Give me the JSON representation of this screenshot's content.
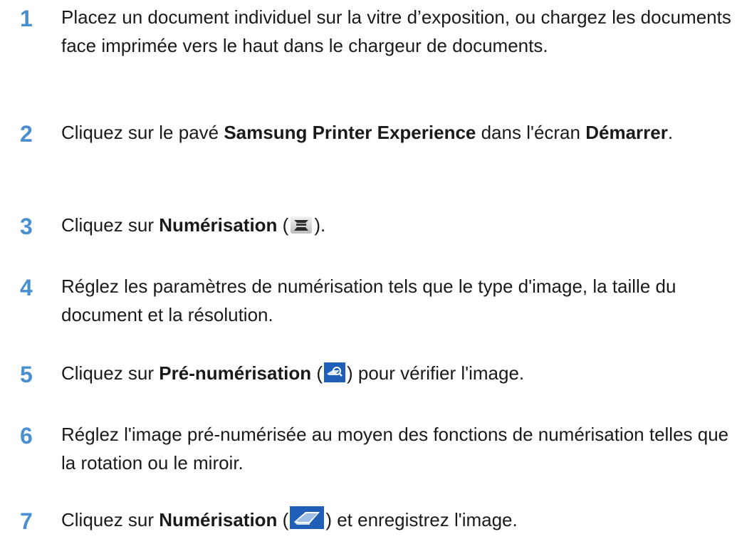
{
  "steps": [
    {
      "number": "1",
      "text": "Placez un document individuel sur la vitre d’exposition, ou chargez les documents face imprimée vers le haut dans le chargeur de documents."
    },
    {
      "number": "2",
      "prefix": "Cliquez sur le pavé ",
      "bold1": "Samsung Printer Experience",
      "middle": " dans l'écran ",
      "bold2": "Démarrer",
      "suffix": "."
    },
    {
      "number": "3",
      "prefix": "Cliquez sur ",
      "bold": "Numérisation",
      "open": " (",
      "close": ").",
      "icon": "scanner-icon"
    },
    {
      "number": "4",
      "text": "Réglez les paramètres de numérisation tels que le type d'image, la taille du document et la résolution."
    },
    {
      "number": "5",
      "prefix": "Cliquez sur ",
      "bold": "Pré-numérisation",
      "open": " (",
      "close": ") pour vérifier l'image.",
      "icon": "preview-scan-icon"
    },
    {
      "number": "6",
      "text": "Réglez l'image pré-numérisée au moyen des fonctions de numérisation telles que la rotation ou le miroir."
    },
    {
      "number": "7",
      "prefix": "Cliquez sur ",
      "bold": "Numérisation",
      "open": " (",
      "close": ") et enregistrez l'image.",
      "icon": "scan-save-icon"
    }
  ],
  "colors": {
    "step_number": "#4a8fd0",
    "body_text": "#1a1a1a",
    "icon_blue": "#1f5fb8"
  }
}
